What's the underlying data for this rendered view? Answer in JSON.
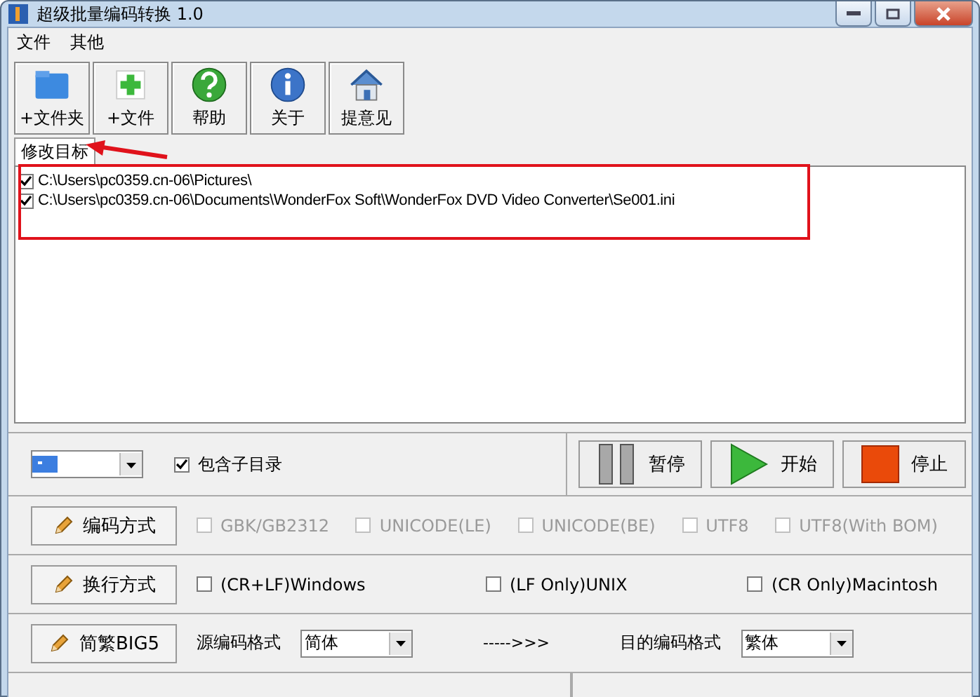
{
  "window": {
    "title": "超级批量编码转换 1.0"
  },
  "menu": [
    "文件",
    "其他"
  ],
  "toolbar": [
    {
      "label": "+文件夹",
      "kind": "folder"
    },
    {
      "label": "+文件",
      "kind": "file"
    },
    {
      "label": "帮助",
      "kind": "help"
    },
    {
      "label": "关于",
      "kind": "info"
    },
    {
      "label": "提意见",
      "kind": "home"
    }
  ],
  "tabs": [
    {
      "label": "修改目标",
      "selected": true
    }
  ],
  "files": [
    {
      "path": "C:\\Users\\pc0359.cn-06\\Pictures\\",
      "checked": true
    },
    {
      "path": "C:\\Users\\pc0359.cn-06\\Documents\\WonderFox Soft\\WonderFox DVD Video Converter\\Se001.ini",
      "checked": true
    }
  ],
  "include_subdirs": {
    "label": "包含子目录",
    "checked": true
  },
  "actions": [
    {
      "label": "暂停",
      "kind": "pause"
    },
    {
      "label": "开始",
      "kind": "start"
    },
    {
      "label": "停止",
      "kind": "stop"
    }
  ],
  "options": [
    {
      "button": "编码方式",
      "kind": "checks",
      "checks": [
        {
          "label": "GBK/GB2312",
          "checked": false,
          "disabled": true
        },
        {
          "label": "UNICODE(LE)",
          "checked": false,
          "disabled": true
        },
        {
          "label": "UNICODE(BE)",
          "checked": false,
          "disabled": true
        },
        {
          "label": "UTF8",
          "checked": false,
          "disabled": true
        },
        {
          "label": "UTF8(With BOM)",
          "checked": false,
          "disabled": true
        }
      ]
    },
    {
      "button": "换行方式",
      "kind": "checks",
      "checks": [
        {
          "label": "(CR+LF)Windows",
          "checked": false,
          "disabled": false
        },
        {
          "label": "(LF Only)UNIX",
          "checked": false,
          "disabled": false
        },
        {
          "label": "(CR Only)Macintosh",
          "checked": false,
          "disabled": false
        }
      ]
    },
    {
      "button": "简繁BIG5",
      "kind": "convert",
      "source_label": "源编码格式",
      "source": "简体",
      "arrow": "----->>>",
      "target_label": "目的编码格式",
      "target": "繁体"
    }
  ]
}
